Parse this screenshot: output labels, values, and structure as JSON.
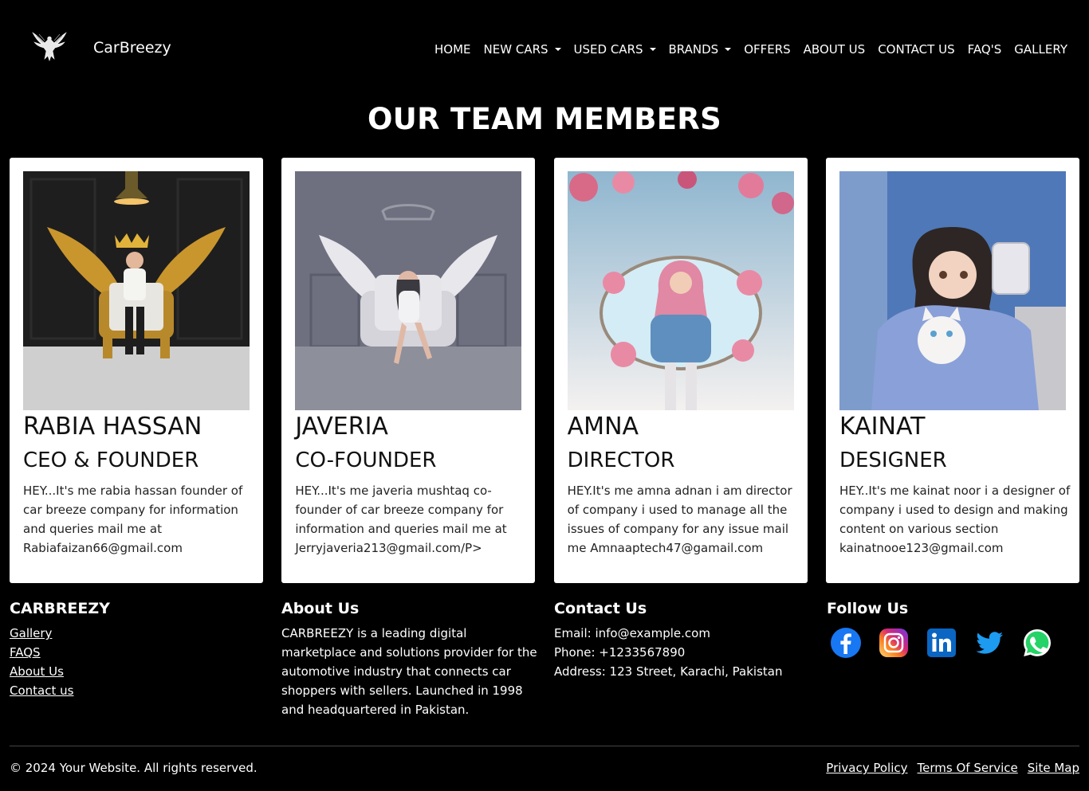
{
  "brand": {
    "name": "CarBreezy",
    "logo": "eagle-logo-icon"
  },
  "nav": [
    {
      "label": "HOME",
      "dropdown": false
    },
    {
      "label": "NEW CARS",
      "dropdown": true
    },
    {
      "label": "USED CARS",
      "dropdown": true
    },
    {
      "label": "BRANDS",
      "dropdown": true
    },
    {
      "label": "OFFERS",
      "dropdown": false
    },
    {
      "label": "ABOUT US",
      "dropdown": false
    },
    {
      "label": "CONTACT US",
      "dropdown": false
    },
    {
      "label": "FAQ'S",
      "dropdown": false
    },
    {
      "label": "GALLERY",
      "dropdown": false
    }
  ],
  "page": {
    "title": "OUR TEAM MEMBERS"
  },
  "team": [
    {
      "name": "RABIA HASSAN",
      "role": "CEO & FOUNDER",
      "bio": "HEY...It's me rabia hassan founder of car breeze company for information and queries mail me at Rabiafaizan66@gmail.com"
    },
    {
      "name": "JAVERIA",
      "role": "CO-FOUNDER",
      "bio": "HEY...It's me javeria mushtaq co-founder of car breeze company for information and queries mail me at Jerryjaveria213@gmail.com/P>"
    },
    {
      "name": "AMNA",
      "role": "DIRECTOR",
      "bio": "HEY.It's me amna adnan i am director of company i used to manage all the issues of company for any issue mail me Amnaaptech47@gamail.com"
    },
    {
      "name": "KAINAT",
      "role": "DESIGNER",
      "bio": "HEY..It's me kainat noor i a designer of company i used to design and making content on various section kainatnooe123@gmail.com"
    }
  ],
  "footer": {
    "col1": {
      "heading": "CARBREEZY",
      "links": [
        "Gallery",
        "FAQS",
        "About Us",
        "Contact us"
      ]
    },
    "col2": {
      "heading": "About Us",
      "text": "CARBREEZY is a leading digital marketplace and solutions provider for the automotive industry that connects car shoppers with sellers. Launched in 1998 and headquartered in Pakistan."
    },
    "col3": {
      "heading": "Contact Us",
      "email": "Email: info@example.com",
      "phone": "Phone: +1233567890",
      "address": "Address: 123 Street, Karachi, Pakistan"
    },
    "col4": {
      "heading": "Follow Us",
      "icons": [
        "facebook-icon",
        "instagram-icon",
        "linkedin-icon",
        "twitter-icon",
        "whatsapp-icon"
      ]
    },
    "copyright": "© 2024 Your Website. All rights reserved.",
    "bottom_links": [
      "Privacy Policy",
      "Terms Of Service",
      "Site Map"
    ]
  },
  "colors": {
    "background": "#000000",
    "card": "#ffffff",
    "facebook": "#1877f2",
    "linkedin": "#0a66c2",
    "twitter": "#1d9bf0",
    "whatsapp": "#25d366"
  }
}
